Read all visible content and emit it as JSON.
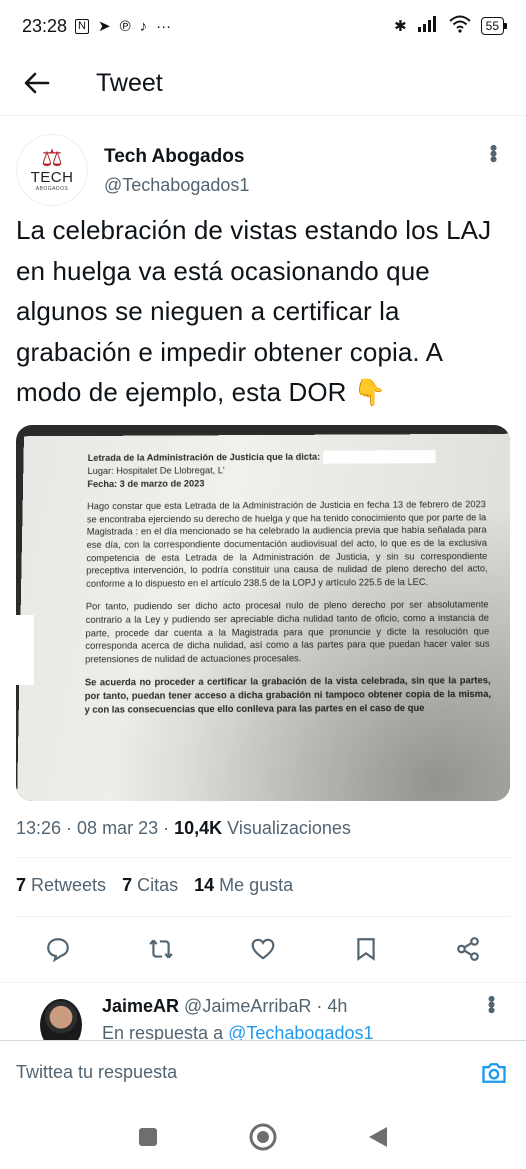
{
  "status_bar": {
    "time": "23:28",
    "left_icons": [
      "nfc-icon",
      "telegram-icon",
      "pinterest-icon",
      "tiktok-icon"
    ],
    "more": "···",
    "battery": "55"
  },
  "header": {
    "back_icon": "arrow-left-icon",
    "title": "Tweet"
  },
  "tweet": {
    "author_name": "Tech Abogados",
    "author_handle": "@Techabogados1",
    "avatar_brand": "TECH",
    "avatar_sub": "ABOGADOS",
    "text": "La celebración de vistas estando los LAJ en huelga va está ocasionando que algunos se nieguen a certificar la grabación e impedir obtener copia. A modo de ejemplo, esta DOR 👇",
    "timestamp": "13:26 · 08 mar 23 · ",
    "views_count": "10,4K",
    "views_label": " Visualizaciones",
    "retweets_count": "7",
    "retweets_label": " Retweets",
    "quotes_count": "7",
    "quotes_label": " Citas",
    "likes_count": "14",
    "likes_label": " Me gusta"
  },
  "document": {
    "line1": "Letrada de la Administración de Justicia que la dicta:",
    "line2": "Lugar: Hospitalet De Llobregat, L'",
    "line3": "Fecha: 3 de marzo de 2023",
    "para1": "Hago constar que esta Letrada de la Administración de Justicia en fecha 13 de febrero de 2023 se encontraba ejerciendo su derecho de huelga y que ha tenido conocimiento que por parte de la Magistrada :                              en el día mencionado se ha celebrado la audiencia previa que había señalada para ese día, con la correspondiente documentación audiovisual del acto, lo que es de la exclusiva competencia de esta Letrada de la Administración de Justicia, y sin su correspondiente preceptiva intervención, lo podría constituir una causa de nulidad de pleno derecho del acto, conforme a lo dispuesto en el artículo 238.5 de la LOPJ y artículo 225.5 de la LEC.",
    "para2": "Por tanto, pudiendo ser dicho acto procesal nulo de pleno derecho por ser absolutamente contrario a la Ley y pudiendo ser apreciable dicha nulidad tanto de oficio, como a instancia de parte, procede dar cuenta a la Magistrada para que pronuncie y dicte la resolución que corresponda acerca de dicha nulidad, así como a las partes para que puedan hacer valer sus pretensiones de nulidad de actuaciones procesales.",
    "para3": "Se acuerda no proceder a certificar la grabación de la vista celebrada, sin que la partes, por tanto, puedan tener acceso a dicha grabación ni tampoco obtener copia de la misma, y con las consecuencias que ello conlleva para las partes en el caso de que"
  },
  "actions": {
    "reply_icon": "reply-icon",
    "retweet_icon": "retweet-icon",
    "like_icon": "heart-icon",
    "bookmark_icon": "bookmark-icon",
    "share_icon": "share-icon"
  },
  "reply": {
    "name": "JaimeAR",
    "handle": " @JaimeArribaR · 4h",
    "to_prefix": "En respuesta a ",
    "to_handle": "@Techabogados1"
  },
  "compose": {
    "placeholder": "Twittea tu respuesta",
    "camera_icon": "camera-icon"
  },
  "navbar": [
    "recents-icon",
    "home-icon",
    "back-icon"
  ]
}
